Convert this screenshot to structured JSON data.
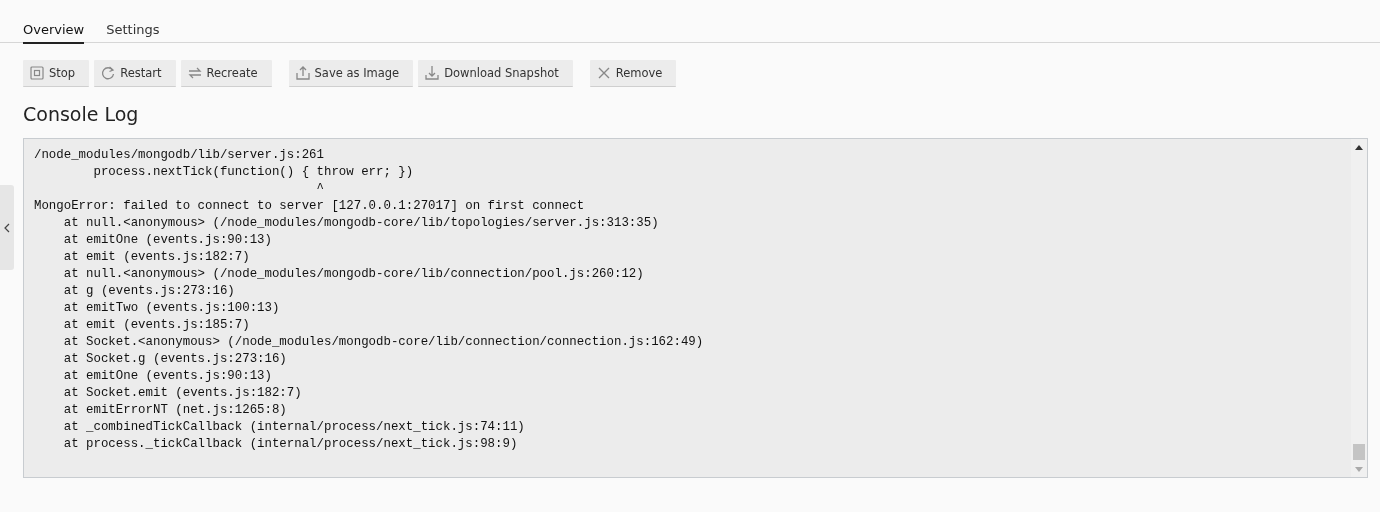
{
  "tabs": [
    {
      "label": "Overview",
      "selected": true
    },
    {
      "label": "Settings",
      "selected": false
    }
  ],
  "toolbar": {
    "groups": [
      [
        {
          "label": "Stop",
          "kind": "stop"
        },
        {
          "label": "Restart",
          "kind": "restart"
        },
        {
          "label": "Recreate",
          "kind": "recreate"
        }
      ],
      [
        {
          "label": "Save as Image",
          "kind": "upload"
        },
        {
          "label": "Download Snapshot",
          "kind": "download"
        }
      ],
      [
        {
          "label": "Remove",
          "kind": "remove"
        }
      ]
    ]
  },
  "heading": "Console Log",
  "console": {
    "lines": [
      "/node_modules/mongodb/lib/server.js:261",
      "        process.nextTick(function() { throw err; })",
      "                                      ^",
      "MongoError: failed to connect to server [127.0.0.1:27017] on first connect",
      "    at null.<anonymous> (/node_modules/mongodb-core/lib/topologies/server.js:313:35)",
      "    at emitOne (events.js:90:13)",
      "    at emit (events.js:182:7)",
      "    at null.<anonymous> (/node_modules/mongodb-core/lib/connection/pool.js:260:12)",
      "    at g (events.js:273:16)",
      "    at emitTwo (events.js:100:13)",
      "    at emit (events.js:185:7)",
      "    at Socket.<anonymous> (/node_modules/mongodb-core/lib/connection/connection.js:162:49)",
      "    at Socket.g (events.js:273:16)",
      "    at emitOne (events.js:90:13)",
      "    at Socket.emit (events.js:182:7)",
      "    at emitErrorNT (net.js:1265:8)",
      "    at _combinedTickCallback (internal/process/next_tick.js:74:11)",
      "    at process._tickCallback (internal/process/next_tick.js:98:9)"
    ]
  }
}
